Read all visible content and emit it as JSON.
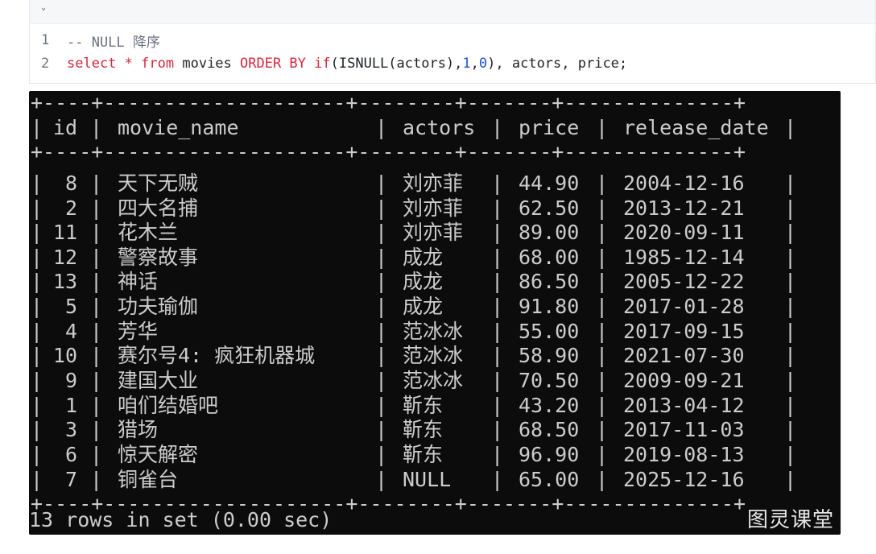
{
  "editor": {
    "lines": [
      {
        "no": "1",
        "comment": "-- NULL 降序"
      },
      {
        "no": "2",
        "tokens": [
          {
            "t": "kw",
            "v": "select"
          },
          {
            "t": "plain",
            "v": " "
          },
          {
            "t": "kw",
            "v": "*"
          },
          {
            "t": "plain",
            "v": " "
          },
          {
            "t": "kw",
            "v": "from"
          },
          {
            "t": "plain",
            "v": " movies "
          },
          {
            "t": "kw",
            "v": "ORDER BY"
          },
          {
            "t": "plain",
            "v": " "
          },
          {
            "t": "kw",
            "v": "if"
          },
          {
            "t": "plain",
            "v": "(ISNULL(actors),"
          },
          {
            "t": "num",
            "v": "1"
          },
          {
            "t": "plain",
            "v": ","
          },
          {
            "t": "num",
            "v": "0"
          },
          {
            "t": "plain",
            "v": "), actors, price;"
          }
        ]
      }
    ]
  },
  "terminal": {
    "border": "+----+--------------------+--------+-------+--------------+",
    "columns": [
      "id",
      "movie_name",
      "actors",
      "price",
      "release_date"
    ],
    "rows": [
      [
        "8",
        "天下无贼",
        "刘亦菲",
        "44.90",
        "2004-12-16"
      ],
      [
        "2",
        "四大名捕",
        "刘亦菲",
        "62.50",
        "2013-12-21"
      ],
      [
        "11",
        "花木兰",
        "刘亦菲",
        "89.00",
        "2020-09-11"
      ],
      [
        "12",
        "警察故事",
        "成龙",
        "68.00",
        "1985-12-14"
      ],
      [
        "13",
        "神话",
        "成龙",
        "86.50",
        "2005-12-22"
      ],
      [
        "5",
        "功夫瑜伽",
        "成龙",
        "91.80",
        "2017-01-28"
      ],
      [
        "4",
        "芳华",
        "范冰冰",
        "55.00",
        "2017-09-15"
      ],
      [
        "10",
        "赛尔号4: 疯狂机器城",
        "范冰冰",
        "58.90",
        "2021-07-30"
      ],
      [
        "9",
        "建国大业",
        "范冰冰",
        "70.50",
        "2009-09-21"
      ],
      [
        "1",
        "咱们结婚吧",
        "靳东",
        "43.20",
        "2013-04-12"
      ],
      [
        "3",
        "猎场",
        "靳东",
        "68.50",
        "2017-11-03"
      ],
      [
        "6",
        "惊天解密",
        "靳东",
        "96.90",
        "2019-08-13"
      ],
      [
        "7",
        "铜雀台",
        "NULL",
        "65.00",
        "2025-12-16"
      ]
    ],
    "status": "13 rows in set (0.00 sec)",
    "watermark": "图灵课堂"
  }
}
